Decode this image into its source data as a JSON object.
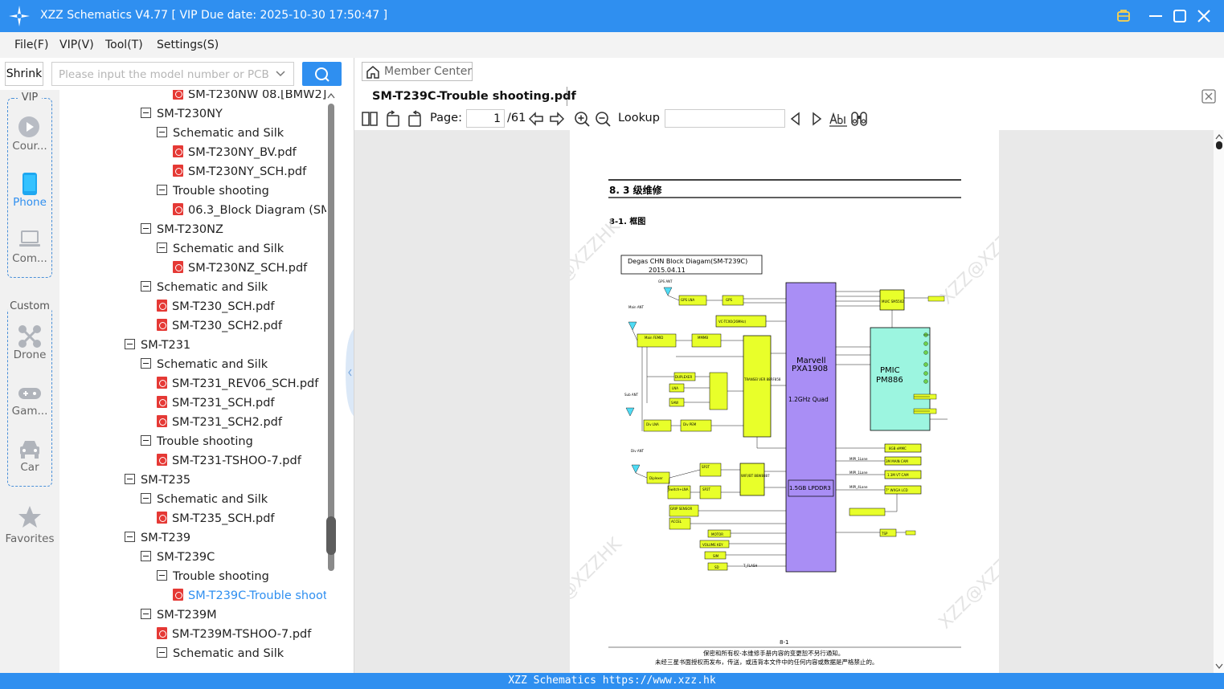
{
  "titlebar": {
    "title": "XZZ Schematics V4.77 [ VIP Due date: 2025-10-30 17:50:47 ]"
  },
  "menu": [
    "File(F)",
    "VIP(V)",
    "Tool(T)",
    "Settings(S)"
  ],
  "search": {
    "shrink_label": "Shrink",
    "placeholder": "Please input the model number or PCB"
  },
  "sidebar": {
    "vip_title": "VIP",
    "vip_items": [
      "Cour...",
      "Phone",
      "Com..."
    ],
    "custom_title": "Custom",
    "custom_items": [
      "Drone",
      "Gam...",
      "Car"
    ],
    "favorites": "Favorites"
  },
  "tree": [
    {
      "label": "SM-T230NW 08.[BMW2]_",
      "type": "pdf",
      "level": 3
    },
    {
      "label": "SM-T230NY",
      "type": "folder",
      "level": 1
    },
    {
      "label": "Schematic and Silk",
      "type": "folder",
      "level": 2
    },
    {
      "label": "SM-T230NY_BV.pdf",
      "type": "pdf",
      "level": 3
    },
    {
      "label": "SM-T230NY_SCH.pdf",
      "type": "pdf",
      "level": 3
    },
    {
      "label": "Trouble shooting",
      "type": "folder",
      "level": 2
    },
    {
      "label": "06.3_Block Diagram (SM-T",
      "type": "pdf",
      "level": 3
    },
    {
      "label": "SM-T230NZ",
      "type": "folder",
      "level": 1
    },
    {
      "label": "Schematic and Silk",
      "type": "folder",
      "level": 2
    },
    {
      "label": "SM-T230NZ_SCH.pdf",
      "type": "pdf",
      "level": 3
    },
    {
      "label": "Schematic and Silk",
      "type": "folder",
      "level": 1
    },
    {
      "label": "SM-T230_SCH.pdf",
      "type": "pdf",
      "level": 2
    },
    {
      "label": "SM-T230_SCH2.pdf",
      "type": "pdf",
      "level": 2
    },
    {
      "label": "SM-T231",
      "type": "folder",
      "level": 0
    },
    {
      "label": "Schematic and Silk",
      "type": "folder",
      "level": 1
    },
    {
      "label": "SM-T231_REV06_SCH.pdf",
      "type": "pdf",
      "level": 2
    },
    {
      "label": "SM-T231_SCH.pdf",
      "type": "pdf",
      "level": 2
    },
    {
      "label": "SM-T231_SCH2.pdf",
      "type": "pdf",
      "level": 2
    },
    {
      "label": "Trouble shooting",
      "type": "folder",
      "level": 1
    },
    {
      "label": "SM-T231-TSHOO-7.pdf",
      "type": "pdf",
      "level": 2
    },
    {
      "label": "SM-T235",
      "type": "folder",
      "level": 0
    },
    {
      "label": "Schematic and Silk",
      "type": "folder",
      "level": 1
    },
    {
      "label": "SM-T235_SCH.pdf",
      "type": "pdf",
      "level": 2
    },
    {
      "label": "SM-T239",
      "type": "folder",
      "level": 0
    },
    {
      "label": "SM-T239C",
      "type": "folder",
      "level": 1
    },
    {
      "label": "Trouble shooting",
      "type": "folder",
      "level": 2
    },
    {
      "label": "SM-T239C-Trouble shooti",
      "type": "pdf",
      "level": 3,
      "selected": true
    },
    {
      "label": "SM-T239M",
      "type": "folder",
      "level": 1
    },
    {
      "label": "SM-T239M-TSHOO-7.pdf",
      "type": "pdf",
      "level": 2
    },
    {
      "label": "Schematic and Silk",
      "type": "folder",
      "level": 2
    }
  ],
  "viewer": {
    "member_center": "Member Center",
    "doc_tab": "SM-T239C-Trouble shooting.pdf",
    "page_label": "Page:",
    "page_current": "1",
    "page_total": "/61",
    "lookup_label": "Lookup"
  },
  "pdf_page": {
    "section": "8. 3 级维修",
    "subsection": "8-1.  框图",
    "diagram_title": "Degas CHN Block Diagam(SM-T239C)",
    "diagram_date": "2015.04.11",
    "watermark": "XZZ@XZZHK",
    "labels": {
      "gps_ant": "GPS ANT",
      "main_ant": "Main ANT",
      "sub_ant": "Sub ANT",
      "div_ant": "Div ANT",
      "cpu1": "Marvell",
      "cpu2": "PXA1908",
      "cpu3": "1.2GHz Quad",
      "pmic1": "PMIC",
      "pmic2": "PM886",
      "muic": "MUIC SM5502",
      "trans": "TRANSEI VER 88RF858",
      "wifi": "WIFI/BT 88W8887",
      "lpddr": "1.5GB LPDDR3",
      "emmc": "8GB eMMC",
      "cam_main": "3M MAIN CAM",
      "cam_vt": "1.3M VT CAM",
      "lcd": "7\" WXGA LCD",
      "tcxo": "VC-TCXO(26MHz)",
      "gps_lna": "GPS LNA",
      "gps": "GPS",
      "femid": "Main FEMID",
      "mmmb": "MMMB",
      "duplexer": "DUPLEXER",
      "lna": "LNA",
      "saw": "SAW",
      "div_lna": "Div LNA",
      "div_pem": "Div PEM",
      "diplexer": "Diplexer",
      "sp3t": "SP3T",
      "switch_lna": "Switch+LNA",
      "sp2t": "SP2T",
      "grip": "GRIP SENSOR",
      "accel": "ACCEL",
      "motor": "MOTOR",
      "vol_key": "VOLUME KEY",
      "sim": "SIM",
      "sd": "SD",
      "t_flash": "T_FLASH",
      "tsp": "TSP",
      "mipi1": "MIPI_1Lane",
      "mipi2": "MIPI_1Lane",
      "mipi3": "MIPI_4Lane"
    },
    "page_number": "8-1",
    "footer1": "保密和所有权-本维修手册内容的变更恕不另行通知。",
    "footer2": "未经三星书面授权而发布，传送，或违背本文件中的任何内容或数据是严格禁止的。"
  },
  "statusbar": {
    "text": "XZZ Schematics https://www.xzz.hk"
  },
  "colors": {
    "accent": "#2f8ff0",
    "cpu": "#a98ef5",
    "pmic": "#9cf5e0",
    "chip": "#e8ff2a",
    "selected_item": "#2f8ff0"
  }
}
